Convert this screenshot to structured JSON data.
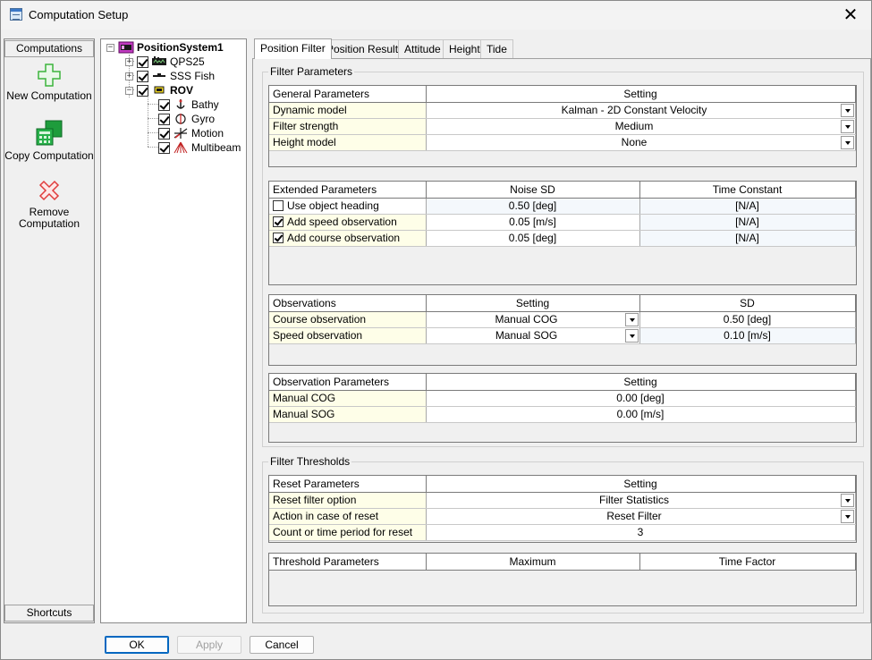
{
  "window": {
    "title": "Computation Setup",
    "close_symbol": "✕"
  },
  "left_panel": {
    "header": "Computations",
    "footer": "Shortcuts",
    "tools": [
      {
        "label": "New Computation",
        "icon": "plus-icon",
        "color": "#3cb43c"
      },
      {
        "label": "Copy Computation",
        "icon": "calculator-icon",
        "color": "#1e9c3c"
      },
      {
        "label_line1": "Remove",
        "label_line2": "Computation",
        "icon": "remove-x-icon",
        "color": "#e03c3c"
      }
    ]
  },
  "tree": {
    "expander_collapsed": "+",
    "expander_expanded": "−",
    "root": {
      "label": "PositionSystem1",
      "icon": "position-system-icon"
    },
    "nodes": [
      {
        "label": "QPS25",
        "icon": "vessel-icon",
        "checked": true,
        "expandable": true
      },
      {
        "label": "SSS Fish",
        "icon": "towfish-icon",
        "checked": true,
        "expandable": true
      },
      {
        "label": "ROV",
        "icon": "rov-icon",
        "checked": true,
        "expandable": true,
        "bold": true
      }
    ],
    "children": [
      {
        "label": "Bathy",
        "icon": "bathy-icon",
        "checked": true
      },
      {
        "label": "Gyro",
        "icon": "gyro-icon",
        "checked": true
      },
      {
        "label": "Motion",
        "icon": "motion-icon",
        "checked": true
      },
      {
        "label": "Multibeam",
        "icon": "multibeam-icon",
        "checked": true
      }
    ]
  },
  "tabs": [
    "Position Filter",
    "Position Results",
    "Attitude",
    "Height",
    "Tide"
  ],
  "filter_parameters": {
    "legend": "Filter Parameters",
    "general": {
      "headers": [
        "General Parameters",
        "Setting"
      ],
      "rows": [
        {
          "label": "Dynamic model",
          "value": "Kalman - 2D Constant Velocity"
        },
        {
          "label": "Filter strength",
          "value": "Medium"
        },
        {
          "label": "Height model",
          "value": "None"
        }
      ]
    },
    "extended": {
      "headers": [
        "Extended Parameters",
        "Noise SD",
        "Time Constant"
      ],
      "rows": [
        {
          "label": "Use object heading",
          "checked": false,
          "noise": "0.50 [deg]",
          "time": "[N/A]"
        },
        {
          "label": "Add speed observation",
          "checked": true,
          "noise": "0.05 [m/s]",
          "time": "[N/A]"
        },
        {
          "label": "Add course observation",
          "checked": true,
          "noise": "0.05 [deg]",
          "time": "[N/A]"
        }
      ]
    },
    "observations": {
      "headers": [
        "Observations",
        "Setting",
        "SD"
      ],
      "rows": [
        {
          "label": "Course observation",
          "setting": "Manual COG",
          "sd": "0.50 [deg]"
        },
        {
          "label": "Speed observation",
          "setting": "Manual SOG",
          "sd": "0.10 [m/s]"
        }
      ]
    },
    "observation_params": {
      "headers": [
        "Observation Parameters",
        "Setting"
      ],
      "rows": [
        {
          "label": "Manual COG",
          "value": "0.00 [deg]"
        },
        {
          "label": "Manual SOG",
          "value": "0.00 [m/s]"
        }
      ]
    }
  },
  "filter_thresholds": {
    "legend": "Filter Thresholds",
    "reset": {
      "headers": [
        "Reset Parameters",
        "Setting"
      ],
      "rows": [
        {
          "label": "Reset filter option",
          "value": "Filter Statistics"
        },
        {
          "label": "Action in case of reset",
          "value": "Reset Filter"
        },
        {
          "label": "Count or time period for reset",
          "value": "3"
        }
      ]
    },
    "threshold": {
      "headers": [
        "Threshold Parameters",
        "Maximum",
        "Time Factor"
      ]
    }
  },
  "buttons": {
    "ok": "OK",
    "apply": "Apply",
    "cancel": "Cancel"
  }
}
